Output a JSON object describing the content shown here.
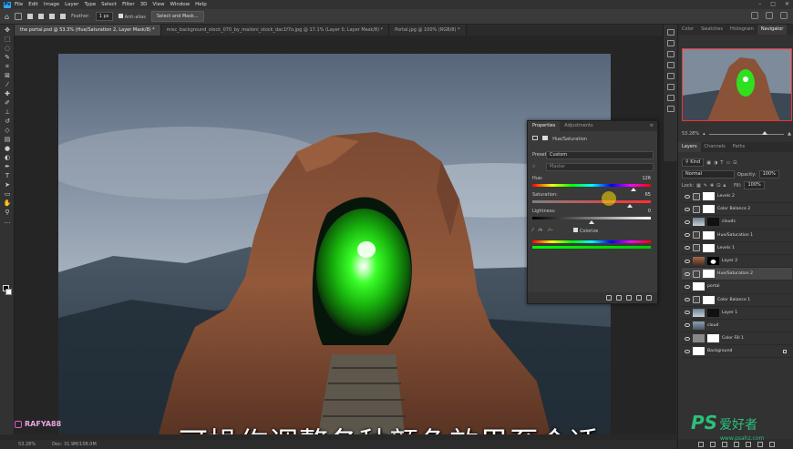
{
  "menubar": {
    "logo": "Ps",
    "items": [
      "File",
      "Edit",
      "Image",
      "Layer",
      "Type",
      "Select",
      "Filter",
      "3D",
      "View",
      "Window",
      "Help"
    ]
  },
  "options": {
    "feather_label": "Feather:",
    "feather_value": "1 px",
    "antialias_label": "Anti-alias",
    "select_mask_label": "Select and Mask..."
  },
  "tabs": [
    {
      "label": "the portal.psd @ 53.3% (Hue/Saturation 2, Layer Mask/8) *"
    },
    {
      "label": "misc_background_stock_070_by_mailoni_stock_dac1f7o.jpg @ 17.1% (Layer 0, Layer Mask/8) *"
    },
    {
      "label": "Portal.jpg @ 100% (RGB/8) *"
    }
  ],
  "statusbar": {
    "zoom": "53.28%",
    "doc": "Doc: 31.9M/108.0M"
  },
  "subtitle": "可操作调整各种颜色效果至合适",
  "watermark": {
    "handle": "RAFYA88",
    "site_ps": "PS",
    "site_cn": "爱好者",
    "site_url": "www.psahz.com"
  },
  "properties": {
    "tab_properties": "Properties",
    "tab_adjustments": "Adjustments",
    "type_label": "Hue/Saturation",
    "preset_label": "Preset:",
    "preset_value": "Custom",
    "channel_value": "Master",
    "hue_label": "Hue:",
    "hue_value": "126",
    "saturation_label": "Saturation:",
    "saturation_value": "65",
    "lightness_label": "Lightness:",
    "lightness_value": "0",
    "colorize_label": "Colorize",
    "hue_fraction": 0.85,
    "saturation_fraction": 0.82,
    "lightness_fraction": 0.5
  },
  "right_panel": {
    "top_tabs": [
      "Color",
      "Swatches",
      "Histogram",
      "Navigator"
    ],
    "nav_zoom": "53.28%",
    "layer_tabs": [
      "Layers",
      "Channels",
      "Paths"
    ],
    "kind_label": "Kind",
    "blend_mode": "Normal",
    "opacity_label": "Opacity:",
    "opacity_value": "100%",
    "lock_label": "Lock:",
    "fill_label": "Fill:",
    "fill_value": "100%"
  },
  "layers": [
    {
      "name": "Levels 2",
      "type": "adj",
      "mask": "white"
    },
    {
      "name": "Color Balance 2",
      "type": "adj",
      "mask": "white"
    },
    {
      "name": "clouds",
      "type": "img",
      "mask": "dark"
    },
    {
      "name": "Hue/Saturation 1",
      "type": "adj",
      "mask": "white"
    },
    {
      "name": "Levels 1",
      "type": "adj",
      "mask": "white"
    },
    {
      "name": "Layer 2",
      "type": "img",
      "mask": "portal"
    },
    {
      "name": "Hue/Saturation 2",
      "type": "adj",
      "mask": "white",
      "selected": true
    },
    {
      "name": "portal",
      "type": "img",
      "mask": "none"
    },
    {
      "name": "Color Balance 1",
      "type": "adj",
      "mask": "white"
    },
    {
      "name": "Layer 1",
      "type": "img",
      "mask": "dark"
    },
    {
      "name": "cloud",
      "type": "img",
      "mask": "none"
    },
    {
      "name": "Color Fill 1",
      "type": "fill",
      "mask": "white"
    },
    {
      "name": "Background",
      "type": "bg",
      "mask": "none",
      "locked": true
    }
  ]
}
